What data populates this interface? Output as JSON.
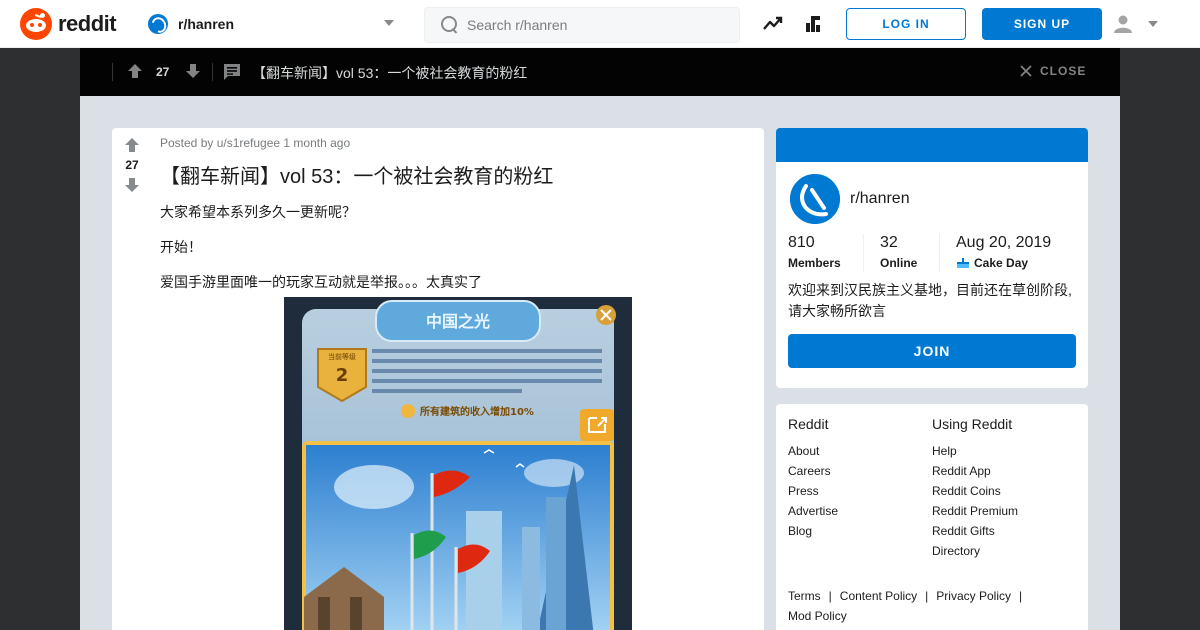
{
  "header": {
    "logo_text": "reddit",
    "subreddit_selector": "r/hanren",
    "search_placeholder": "Search r/hanren",
    "login_label": "LOG IN",
    "signup_label": "SIGN UP"
  },
  "overlay": {
    "vote_count": "27",
    "post_title": "【翻车新闻】vol 53：一个被社会教育的粉红",
    "close_label": "CLOSE"
  },
  "post": {
    "vote_count": "27",
    "meta": "Posted by u/s1refugee 1 month ago",
    "title": "【翻车新闻】vol 53：一个被社会教育的粉红",
    "paragraphs": [
      "大家希望本系列多久一更新呢？",
      "开始！",
      "爱国手游里面唯一的玩家互动就是举报。。。太真实了"
    ],
    "image": {
      "heading": "中国之光",
      "level_label": "当前等级",
      "level_value": "2",
      "bonus_text": "所有建筑的收入增加10%"
    }
  },
  "about": {
    "name": "r/hanren",
    "members_value": "810",
    "members_label": "Members",
    "online_value": "32",
    "online_label": "Online",
    "cake_value": "Aug 20, 2019",
    "cake_label": "Cake Day",
    "description": "欢迎来到汉民族主义基地，目前还在草创阶段,请大家畅所欲言",
    "join_label": "JOIN"
  },
  "footer": {
    "col1_title": "Reddit",
    "col1_links": [
      "About",
      "Careers",
      "Press",
      "Advertise",
      "Blog"
    ],
    "col2_title": "Using Reddit",
    "col2_links": [
      "Help",
      "Reddit App",
      "Reddit Coins",
      "Reddit Premium",
      "Reddit Gifts",
      "Directory"
    ],
    "bottom_links": [
      "Terms",
      "Content Policy",
      "Privacy Policy",
      "Mod Policy"
    ]
  },
  "colors": {
    "brand": "#ff4500",
    "accent": "#0079d3",
    "overlay_bg": "#030303",
    "page_bg": "#dae0e6"
  }
}
